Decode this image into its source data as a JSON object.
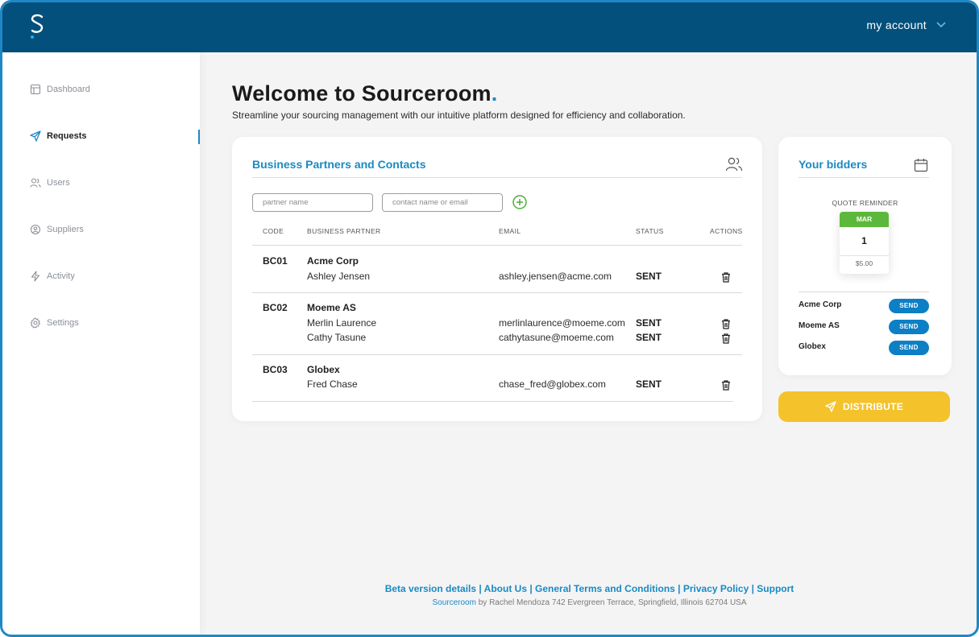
{
  "header": {
    "account_label": "my account"
  },
  "sidebar": {
    "items": [
      {
        "label": "Dashboard",
        "icon": "dashboard-icon"
      },
      {
        "label": "Requests",
        "icon": "send-icon"
      },
      {
        "label": "Users",
        "icon": "users-icon"
      },
      {
        "label": "Suppliers",
        "icon": "suppliers-icon"
      },
      {
        "label": "Activity",
        "icon": "lightning-icon"
      },
      {
        "label": "Settings",
        "icon": "gear-icon"
      }
    ],
    "active": "Requests"
  },
  "main": {
    "title": "Welcome to Sourceroom",
    "title_dot": ".",
    "subtitle": "Streamline your sourcing management with our intuitive platform designed for efficiency and  collaboration."
  },
  "partners_card": {
    "title": "Business Partners and Contacts",
    "partner_placeholder": "partner name",
    "contact_placeholder": "contact name or email",
    "columns": [
      "CODE",
      "BUSINESS PARTNER",
      "EMAIL",
      "STATUS",
      "ACTIONS"
    ],
    "rows": [
      {
        "code": "BC01",
        "partner": "Acme Corp",
        "contacts": [
          {
            "name": "Ashley Jensen",
            "email": "ashley.jensen@acme.com",
            "status": "SENT"
          }
        ]
      },
      {
        "code": "BC02",
        "partner": "Moeme AS",
        "contacts": [
          {
            "name": "Merlin Laurence",
            "email": "merlinlaurence@moeme.com",
            "status": "SENT"
          },
          {
            "name": "Cathy Tasune",
            "email": "cathytasune@moeme.com",
            "status": "SENT"
          }
        ]
      },
      {
        "code": "BC03",
        "partner": "Globex",
        "contacts": [
          {
            "name": "Fred Chase",
            "email": "chase_fred@globex.com",
            "status": "SENT"
          }
        ]
      }
    ]
  },
  "bidders_card": {
    "title": "Your bidders",
    "reminder_label": "QUOTE REMINDER",
    "calendar": {
      "month": "MAR",
      "day": "1",
      "price": "$5.00"
    },
    "bidders": [
      {
        "name": "Acme Corp",
        "action": "SEND"
      },
      {
        "name": "Moeme AS",
        "action": "SEND"
      },
      {
        "name": "Globex",
        "action": "SEND"
      }
    ]
  },
  "distribute_label": "DISTRIBUTE",
  "footer": {
    "links": [
      "Beta version details",
      "About Us",
      "General Terms and Conditions",
      "Privacy Policy",
      "Support"
    ],
    "separator": " | ",
    "brand": "Sourceroom",
    "address": " by Rachel Mendoza 742 Evergreen Terrace, Springfield, Illinois 62704 USA"
  },
  "colors": {
    "topbar": "#03507c",
    "accent": "#1a8ac2",
    "distribute": "#f4c22b",
    "send": "#0d7fc5",
    "calendar_month": "#5cb83a",
    "add_icon": "#4caf3a"
  }
}
